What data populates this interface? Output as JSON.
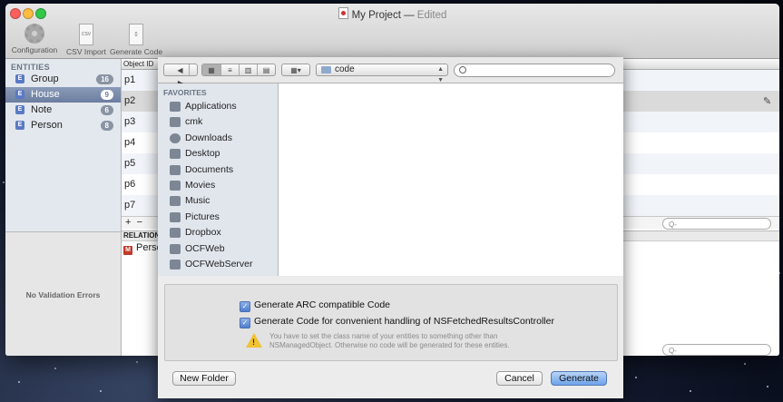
{
  "window": {
    "title": "My Project",
    "status": "Edited"
  },
  "toolbar": [
    {
      "label": "Configuration",
      "icon": "gear-icon"
    },
    {
      "label": "CSV Import",
      "icon": "csv-file-icon",
      "glyph": "CSV"
    },
    {
      "label": "Generate Code",
      "icon": "code-file-icon",
      "glyph": "{}"
    }
  ],
  "sidebar": {
    "section": "ENTITIES",
    "items": [
      {
        "label": "Group",
        "count": "16",
        "glyph": "E"
      },
      {
        "label": "House",
        "count": "9",
        "glyph": "E"
      },
      {
        "label": "Note",
        "count": "6",
        "glyph": "E"
      },
      {
        "label": "Person",
        "count": "8",
        "glyph": "E"
      }
    ],
    "validation": "No Validation Errors"
  },
  "table": {
    "header": "Object ID",
    "rows": [
      "p1",
      "p2",
      "p3",
      "p4",
      "p5",
      "p6",
      "p7"
    ],
    "add": "+",
    "remove": "−",
    "relations_header": "RELATION",
    "relation_item": "Perso",
    "relation_glyph": "M",
    "search_glyph": "Q-"
  },
  "sheet": {
    "path": "code",
    "favorites_title": "FAVORITES",
    "favorites": [
      {
        "label": "Applications",
        "icon": "applications-icon"
      },
      {
        "label": "cmk",
        "icon": "home-icon"
      },
      {
        "label": "Downloads",
        "icon": "downloads-icon"
      },
      {
        "label": "Desktop",
        "icon": "desktop-icon"
      },
      {
        "label": "Documents",
        "icon": "documents-icon"
      },
      {
        "label": "Movies",
        "icon": "movies-icon"
      },
      {
        "label": "Music",
        "icon": "music-icon"
      },
      {
        "label": "Pictures",
        "icon": "pictures-icon"
      },
      {
        "label": "Dropbox",
        "icon": "folder-icon"
      },
      {
        "label": "OCFWeb",
        "icon": "folder-icon"
      },
      {
        "label": "OCFWebServer",
        "icon": "folder-icon"
      }
    ],
    "options": {
      "arc": "Generate ARC compatible Code",
      "frc": "Generate Code for convenient handling of NSFetchedResultsController",
      "warning": "You have to set the class name of your entities to something other than NSManagedObject. Otherwise no code will be generated for these entities.",
      "check_glyph": "✓",
      "warn_glyph": "!"
    },
    "buttons": {
      "new_folder": "New Folder",
      "cancel": "Cancel",
      "generate": "Generate"
    }
  },
  "colors": {
    "accent": "#6c7ea0",
    "default_button": "#6da3ea",
    "badge": "#8a93a3",
    "warning": "#f1c232",
    "close": "#fc605c",
    "minimize": "#fdbc40",
    "zoom": "#34c84a"
  }
}
